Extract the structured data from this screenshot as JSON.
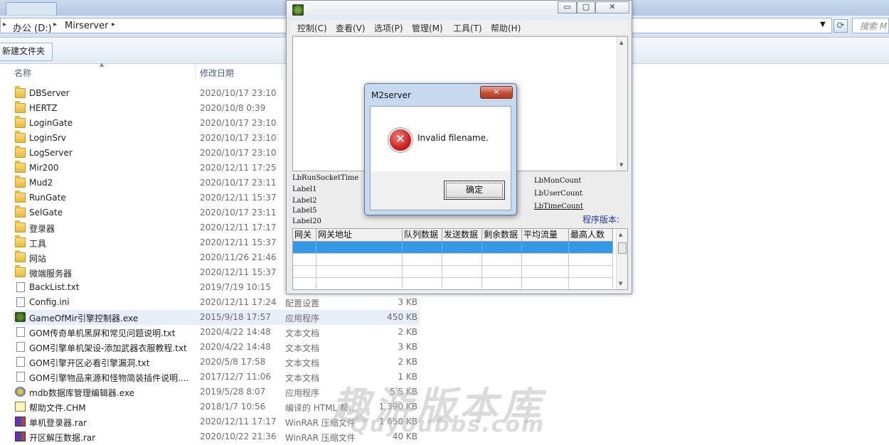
{
  "explorer": {
    "breadcrumb": [
      "办公 (D:)",
      "Mirserver"
    ],
    "search_placeholder": "搜索 M",
    "new_folder_label": "新建文件夹",
    "columns": {
      "name": "名称",
      "date": "修改日期"
    },
    "rows": [
      {
        "name": "DBServer",
        "date": "2020/10/17 23:10",
        "type": "",
        "size": "",
        "icon": "folder-icon"
      },
      {
        "name": "HERTZ",
        "date": "2020/10/8 0:39",
        "type": "",
        "size": "",
        "icon": "folder-icon"
      },
      {
        "name": "LoginGate",
        "date": "2020/10/17 23:10",
        "type": "",
        "size": "",
        "icon": "folder-icon"
      },
      {
        "name": "LoginSrv",
        "date": "2020/10/17 23:10",
        "type": "",
        "size": "",
        "icon": "folder-icon"
      },
      {
        "name": "LogServer",
        "date": "2020/10/17 23:10",
        "type": "",
        "size": "",
        "icon": "folder-icon"
      },
      {
        "name": "Mir200",
        "date": "2020/12/11 17:25",
        "type": "",
        "size": "",
        "icon": "folder-icon"
      },
      {
        "name": "Mud2",
        "date": "2020/10/17 23:11",
        "type": "",
        "size": "",
        "icon": "folder-icon"
      },
      {
        "name": "RunGate",
        "date": "2020/12/11 15:37",
        "type": "",
        "size": "",
        "icon": "folder-icon"
      },
      {
        "name": "SelGate",
        "date": "2020/10/17 23:11",
        "type": "",
        "size": "",
        "icon": "folder-icon"
      },
      {
        "name": "登录器",
        "date": "2020/12/11 17:17",
        "type": "",
        "size": "",
        "icon": "folder-icon"
      },
      {
        "name": "工具",
        "date": "2020/12/11 15:37",
        "type": "",
        "size": "",
        "icon": "folder-icon"
      },
      {
        "name": "网站",
        "date": "2020/11/26 21:46",
        "type": "",
        "size": "",
        "icon": "folder-icon"
      },
      {
        "name": "微端服务器",
        "date": "2020/12/11 15:37",
        "type": "",
        "size": "",
        "icon": "folder-icon"
      },
      {
        "name": "BackList.txt",
        "date": "2019/7/19 10:15",
        "type": "",
        "size": "",
        "icon": "text-file-icon"
      },
      {
        "name": "Config.ini",
        "date": "2020/12/11 17:24",
        "type": "配置设置",
        "size": "3 KB",
        "icon": "config-file-icon"
      },
      {
        "name": "GameOfMir引擎控制器.exe",
        "date": "2015/9/18 17:57",
        "type": "应用程序",
        "size": "450 KB",
        "icon": "app-icon",
        "selected": true
      },
      {
        "name": "GOM传奇单机黑屏和常见问题说明.txt",
        "date": "2020/4/22 14:48",
        "type": "文本文档",
        "size": "2 KB",
        "icon": "text-file-icon"
      },
      {
        "name": "GOM引擎单机架设-添加武器衣服教程.txt",
        "date": "2020/4/22 14:48",
        "type": "文本文档",
        "size": "3 KB",
        "icon": "text-file-icon"
      },
      {
        "name": "GOM引擎开区必看引擎漏洞.txt",
        "date": "2020/5/8 17:58",
        "type": "文本文档",
        "size": "2 KB",
        "icon": "text-file-icon"
      },
      {
        "name": "GOM引擎物品来源和怪物简装插件说明....",
        "date": "2017/12/7 11:06",
        "type": "文本文档",
        "size": "1 KB",
        "icon": "text-file-icon"
      },
      {
        "name": "mdb数据库管理编辑器.exe",
        "date": "2019/5/28 8:07",
        "type": "应用程序",
        "size": "5 5 KB",
        "icon": "database-app-icon"
      },
      {
        "name": "帮助文件.CHM",
        "date": "2018/1/7 10:56",
        "type": "编译的 HTML 帮...",
        "size": "1,390 KB",
        "icon": "help-file-icon"
      },
      {
        "name": "单机登录器.rar",
        "date": "2020/12/11 17:17",
        "type": "WinRAR 压缩文件",
        "size": "1 650 KB",
        "icon": "rar-archive-icon"
      },
      {
        "name": "开区解压数据.rar",
        "date": "2020/10/22 21:36",
        "type": "WinRAR 压缩文件",
        "size": "40 KB",
        "icon": "rar-archive-icon"
      }
    ]
  },
  "m2": {
    "window_buttons": {
      "minimize": "▭",
      "maximize": "▢",
      "close": "✕"
    },
    "menu": [
      "控制(C)",
      "查看(V)",
      "选项(P)",
      "管理(M)",
      "工具(T)",
      "帮助(H)"
    ],
    "status_left": [
      "LbRunSocketTime",
      "Label1",
      "Label2",
      "Label5",
      "Label20"
    ],
    "status_right": [
      "LbMonCount",
      "LbUserCount",
      "LbTimeCount"
    ],
    "version_label": "程序版本:",
    "grid_headers": [
      "网关",
      "网关地址",
      "队列数据",
      "发送数据",
      "剩余数据",
      "平均流量",
      "最高人数"
    ]
  },
  "dialog": {
    "title": "M2server",
    "message": "Invalid filename.",
    "ok_label": "确定",
    "close_glyph": "✕",
    "error_glyph": "✕"
  },
  "watermark": {
    "cn": "趣游版本库",
    "en": "Quyoubbs.com"
  },
  "colors": {
    "selection": "#3398e6",
    "dialog_frame": "#c7d9ef",
    "error_red": "#d02020"
  }
}
